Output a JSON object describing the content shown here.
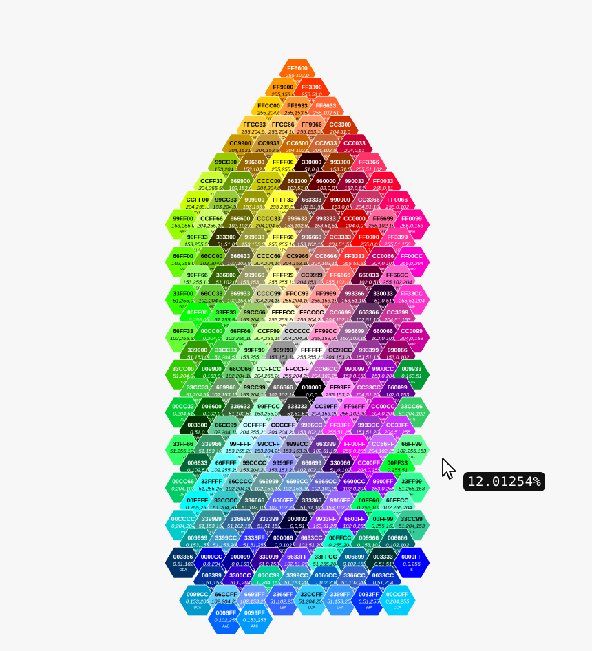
{
  "zoom_readout": "12.01254%",
  "cells": [
    [
      "FF6600",
      "255,102,0",
      "OOR"
    ],
    [
      "FF9900",
      "255,153,0",
      "OOY"
    ],
    [
      "FF3300",
      "255,51,0",
      "RRO"
    ],
    [
      "FFCC00",
      "255,204,0",
      "YYO"
    ],
    [
      "FF9933",
      "255,153,51",
      "LHO"
    ],
    [
      "FF6633",
      "255,102,51",
      "LRO"
    ],
    [
      "FFCC33",
      "255,204,51",
      "LYO"
    ],
    [
      "FFCC66",
      "255,204,102",
      "LOY"
    ],
    [
      "FF9966",
      "255,153,102",
      "LOR"
    ],
    [
      "CC3300",
      "204,51,0",
      "DRO"
    ],
    [
      "CC9900",
      "204,153,0",
      "DYO"
    ],
    [
      "CC9933",
      "204,153,51",
      "MOY"
    ],
    [
      "CC6600",
      "204,102,0",
      "DHO"
    ],
    [
      "CC6633",
      "204,102,51",
      "MOR"
    ],
    [
      "CC0033",
      "204,0,51",
      "DRP"
    ],
    [
      "99CC00",
      "153,204,0",
      "DYS"
    ],
    [
      "996600",
      "153,102,0",
      "DOY"
    ],
    [
      "FFFF00",
      "255,255,0",
      "Y"
    ],
    [
      "330000",
      "51,0,0",
      "OWR"
    ],
    [
      "993300",
      "153,51,0",
      "DOR"
    ],
    [
      "FF3366",
      "255,51,102",
      "LRP"
    ],
    [
      "CCFF33",
      "204,255,51",
      "LYS"
    ],
    [
      "669900",
      "102,153,0",
      "DSY"
    ],
    [
      "CCCC00",
      "204,204,0",
      "DHY"
    ],
    [
      "663300",
      "102,51,0",
      "ODO"
    ],
    [
      "660000",
      "102,0,0",
      "ODR"
    ],
    [
      "990033",
      "153,0,51",
      "DPR"
    ],
    [
      "FF0033",
      "255,0,51",
      "RRP"
    ],
    [
      "CCFF00",
      "204,255,0",
      "YYS"
    ],
    [
      "99CC33",
      "153,204,51",
      "MSY"
    ],
    [
      "999900",
      "153,153,0",
      "DFY"
    ],
    [
      "FFFF33",
      "255,255,51",
      "LHY"
    ],
    [
      "663333",
      "102,51,51",
      "DWR"
    ],
    [
      "990000",
      "153,0,0",
      "DFR"
    ],
    [
      "CC3366",
      "204,51,102",
      "MPR"
    ],
    [
      "FF0066",
      "255,0,102",
      "PPR"
    ],
    [
      "99FF00",
      "153,255,0",
      "SSY"
    ],
    [
      "CCFF66",
      "204,255,102",
      "LSY"
    ],
    [
      "666600",
      "102,102,0",
      "ODY"
    ],
    [
      "CCCC33",
      "204,204,51",
      "MFY"
    ],
    [
      "996633",
      "153,102,51",
      "DDO"
    ],
    [
      "993333",
      "153,51,51",
      "DDR"
    ],
    [
      "CC0000",
      "204,0,0",
      "DHR"
    ],
    [
      "FF6699",
      "255,102,153",
      "LPR"
    ],
    [
      "FF0099",
      "255,0,153",
      "PPM"
    ],
    [
      "99FF33",
      "153,255,51",
      "LHS"
    ],
    [
      "333300",
      "51,51,0",
      "OWY"
    ],
    [
      "999933",
      "153,153,51",
      "DDY"
    ],
    [
      "FFFF66",
      "255,255,102",
      "LFY"
    ],
    [
      "996666",
      "153,102,102",
      "MWR"
    ],
    [
      "CC3333",
      "204,51,51",
      "MFR"
    ],
    [
      "FF0000",
      "255,0,0",
      "R"
    ],
    [
      "FF3399",
      "255,51,153",
      "LHP"
    ],
    [
      "66FF00",
      "102,255,0",
      "SSG"
    ],
    [
      "66CC00",
      "102,204,0",
      "DHS"
    ],
    [
      "666633",
      "102,102,51",
      "DWY"
    ],
    [
      "CCCC66",
      "204,204,102",
      "LDY"
    ],
    [
      "CC9966",
      "204,153,102",
      "LDO"
    ],
    [
      "CC6666",
      "204,102,102",
      "LDR"
    ],
    [
      "FF3333",
      "255,51,51",
      "LHR"
    ],
    [
      "CC0066",
      "204,0,102",
      "DHP"
    ],
    [
      "FF00CC",
      "255,0,204",
      "MMP"
    ],
    [
      "99FF66",
      "153,255,102",
      "LSG"
    ],
    [
      "336600",
      "51,102,0",
      "OOS"
    ],
    [
      "999966",
      "153,153,102",
      "MWY"
    ],
    [
      "FFFF99",
      "255,255,153",
      "PDY"
    ],
    [
      "CC9999",
      "204,153,153",
      "LWR"
    ],
    [
      "FF6666",
      "255,102,102",
      "LFR"
    ],
    [
      "660033",
      "102,0,51",
      "ODP"
    ],
    [
      "FF66CC",
      "255,102,204",
      "LPM"
    ],
    [
      "33FF00",
      "51,255,0",
      "GGS"
    ],
    [
      "66CC33",
      "102,204,51",
      "MSG"
    ],
    [
      "669933",
      "102,153,51",
      "DDS"
    ],
    [
      "CCCC99",
      "204,204,153",
      "LWY"
    ],
    [
      "FFCC99",
      "255,204,153",
      "PDO"
    ],
    [
      "FF9999",
      "255,153,153",
      "PDR"
    ],
    [
      "993366",
      "153,51,102",
      "DDP"
    ],
    [
      "330033",
      "51,0,51",
      "OWM"
    ],
    [
      "FF33CC",
      "255,51,204",
      "LMP"
    ],
    [
      "00FF00",
      "0,255,0",
      "G"
    ],
    [
      "33FF33",
      "51,255,51",
      "LHG"
    ],
    [
      "99CC66",
      "153,204,102",
      "LDS"
    ],
    [
      "FFFFCC",
      "255,255,204",
      "PWY"
    ],
    [
      "FFCCCC",
      "255,204,204",
      "PWR"
    ],
    [
      "CC6699",
      "204,102,153",
      "LDP"
    ],
    [
      "663366",
      "102,51,102",
      "DWM"
    ],
    [
      "CC3399",
      "204,51,153",
      "MPM"
    ],
    [
      "66FF33",
      "102,255,51",
      "LGS"
    ],
    [
      "00CC00",
      "0,204,0",
      "DHG"
    ],
    [
      "66FF66",
      "102,255,102",
      "LFG"
    ],
    [
      "CCFF99",
      "204,255,153",
      "PDS"
    ],
    [
      "CCCCCC",
      "204,204,204",
      "PG"
    ],
    [
      "FF99CC",
      "255,153,204",
      "PDP"
    ],
    [
      "996699",
      "153,102,153",
      "MWM"
    ],
    [
      "660066",
      "102,0,102",
      "ODM"
    ],
    [
      "CC0099",
      "204,0,153",
      "DMP"
    ],
    [
      "339900",
      "51,153,0",
      "DSG"
    ],
    [
      "33CC33",
      "51,204,51",
      "MFG"
    ],
    [
      "99FF99",
      "153,255,153",
      "PDG"
    ],
    [
      "999999",
      "153,153,153",
      "LG"
    ],
    [
      "FFFFFF",
      "255,255,255",
      "W"
    ],
    [
      "CC99CC",
      "204,153,204",
      "LWM"
    ],
    [
      "993399",
      "153,51,153",
      "DDM"
    ],
    [
      "990066",
      "153,0,102",
      "DPM"
    ],
    [
      "33CC00",
      "51,204,0",
      "DGS"
    ],
    [
      "009900",
      "0,153,0",
      "DFG"
    ],
    [
      "66CC66",
      "102,204,102",
      "LDG"
    ],
    [
      "CCFFCC",
      "204,255,204",
      "PWG"
    ],
    [
      "FFCCFF",
      "255,204,255",
      "PWM"
    ],
    [
      "CC66CC",
      "204,102,204",
      "LDM"
    ],
    [
      "990099",
      "153,0,153",
      "DFM"
    ],
    [
      "9900CC",
      "153,0,204",
      "DMV"
    ],
    [
      "009933",
      "0,153,51",
      "DTG"
    ],
    [
      "33CC33",
      "51,204,51",
      "MFG"
    ],
    [
      "669966",
      "102,153,102",
      "MWG"
    ],
    [
      "99CC99",
      "153,204,153",
      "LWG"
    ],
    [
      "666666",
      "102,102,102",
      "DG"
    ],
    [
      "000000",
      "0,0,0",
      "K"
    ],
    [
      "FF99FF",
      "255,153,255",
      "PDM"
    ],
    [
      "CC33CC",
      "204,51,204",
      "MFM"
    ],
    [
      "660099",
      "102,0,153",
      "DVM"
    ],
    [
      "00CC33",
      "0,204,51",
      "DGT"
    ],
    [
      "006600",
      "0,102,0",
      "ODG"
    ],
    [
      "336633",
      "51,102,51",
      "DWG"
    ],
    [
      "99FFCC",
      "153,255,204",
      "PDT"
    ],
    [
      "333333",
      "51,51,51",
      "OG"
    ],
    [
      "CC99FF",
      "204,153,255",
      "PDV"
    ],
    [
      "FF66FF",
      "255,102,255",
      "LFM"
    ],
    [
      "CC00CC",
      "204,0,204",
      "DHM"
    ],
    [
      "33CC66",
      "51,204,102",
      "MTG"
    ],
    [
      "003300",
      "0,51,0",
      "OWG"
    ],
    [
      "66CC99",
      "102,204,153",
      "LDT"
    ],
    [
      "CCFFFF",
      "204,255,255",
      "PWC"
    ],
    [
      "CCCCFF",
      "204,204,255",
      "PWB"
    ],
    [
      "9966CC",
      "153,102,204",
      "LDV"
    ],
    [
      "FF33FF",
      "255,51,255",
      "LHM"
    ],
    [
      "9933CC",
      "153,51,204",
      "MVM"
    ],
    [
      "CC33FF",
      "204,51,255",
      "LMV"
    ],
    [
      "33FF66",
      "51,255,102",
      "LGT"
    ],
    [
      "339966",
      "51,153,102",
      "DDT"
    ],
    [
      "99FFFF",
      "153,255,255",
      "PDC"
    ],
    [
      "99CCFF",
      "153,204,255",
      "PDA"
    ],
    [
      "9999CC",
      "153,153,204",
      "LWB"
    ],
    [
      "663399",
      "102,51,153",
      "DDV"
    ],
    [
      "FF00FF",
      "255,0,255",
      "M"
    ],
    [
      "CC66FF",
      "204,102,255",
      "LVM"
    ],
    [
      "66FF99",
      "102,255,153",
      "LTG"
    ],
    [
      "006633",
      "0,102,51",
      "ODT"
    ],
    [
      "66FFFF",
      "102,255,255",
      "LFC"
    ],
    [
      "99CCCC",
      "153,204,204",
      "LWC"
    ],
    [
      "9999FF",
      "153,153,255",
      "PDB"
    ],
    [
      "666699",
      "102,102,153",
      "MWB"
    ],
    [
      "330066",
      "51,0,102",
      "ODV"
    ],
    [
      "CC00FF",
      "204,0,255",
      "VVM"
    ],
    [
      "00FF33",
      "0,255,51",
      "GGT"
    ],
    [
      "00CC66",
      "0,204,102",
      "DHT"
    ],
    [
      "33FFFF",
      "51,255,255",
      "LHC"
    ],
    [
      "66CCCC",
      "102,204,204",
      "LDC"
    ],
    [
      "669999",
      "102,153,153",
      "MWC"
    ],
    [
      "6699CC",
      "102,153,204",
      "LDA"
    ],
    [
      "6666CC",
      "102,102,204",
      "LDB"
    ],
    [
      "6600CC",
      "102,0,204",
      "DHV"
    ],
    [
      "9900FF",
      "153,0,255",
      "VVM"
    ],
    [
      "33FF99",
      "51,255,153",
      "LHT"
    ],
    [
      "00FFFF",
      "0,255,255",
      "C"
    ],
    [
      "33CCCC",
      "51,204,204",
      "MFC"
    ],
    [
      "336666",
      "51,102,102",
      "DWC"
    ],
    [
      "6666FF",
      "102,102,255",
      "LFB"
    ],
    [
      "333366",
      "51,51,102",
      "DWB"
    ],
    [
      "9966FF",
      "153,102,255",
      "LHV"
    ],
    [
      "00FF66",
      "0,255,102",
      "TTG"
    ],
    [
      "66FFCC",
      "102,255,204",
      "LTC"
    ],
    [
      "00CCCC",
      "0,204,204",
      "DHC"
    ],
    [
      "339999",
      "51,153,153",
      "DDC"
    ],
    [
      "336699",
      "51,102,153",
      "DDA"
    ],
    [
      "333399",
      "51,51,153",
      "DDB"
    ],
    [
      "000033",
      "0,0,51",
      "OWB"
    ],
    [
      "9933FF",
      "153,51,255",
      "LHV"
    ],
    [
      "6600FF",
      "102,0,255",
      "VVB"
    ],
    [
      "00FF99",
      "0,255,153",
      "TTC"
    ],
    [
      "33CC99",
      "51,204,153",
      "MTC"
    ],
    [
      "009999",
      "0,153,153",
      "DFC"
    ],
    [
      "3399CC",
      "51,153,204",
      "MAC"
    ],
    [
      "3333FF",
      "51,51,255",
      "LHB"
    ],
    [
      "000066",
      "0,0,102",
      "ODB"
    ],
    [
      "6633CC",
      "102,51,204",
      "MVB"
    ],
    [
      "00FFCC",
      "0,255,204",
      "CCT"
    ],
    [
      "009966",
      "0,153,102",
      "DTC"
    ],
    [
      "006666",
      "0,102,102",
      "ODC"
    ],
    [
      "003366",
      "0,51,102",
      "ODA"
    ],
    [
      "0000CC",
      "0,0,204",
      "DHB"
    ],
    [
      "000099",
      "0,0,153",
      "DFB"
    ],
    [
      "330099",
      "51,0,153",
      "DVB"
    ],
    [
      "6633FF",
      "102,51,255",
      "LBV"
    ],
    [
      "33FFCC",
      "51,255,204",
      "LCT"
    ],
    [
      "006699",
      "0,102,153",
      "DAC"
    ],
    [
      "003333",
      "0,51,51",
      "OWC"
    ],
    [
      "0000FF",
      "0,0,255",
      "B"
    ],
    [
      "003399",
      "0,51,153",
      "DAB"
    ],
    [
      "3300CC",
      "51,0,204",
      "DBV"
    ],
    [
      "00CC99",
      "0,204,153",
      "DCT"
    ],
    [
      "3399CC",
      "51,153,204",
      "MAC"
    ],
    [
      "0066CC",
      "0,102,204",
      "DHA"
    ],
    [
      "3366CC",
      "51,102,204",
      "MAB"
    ],
    [
      "0033CC",
      "0,51,204",
      "DBA"
    ],
    [
      "0099CC",
      "0,153,204",
      "DCA"
    ],
    [
      "66CCFF",
      "102,204,255",
      "LAC"
    ],
    [
      "6699FF",
      "102,153,255",
      "LAB"
    ],
    [
      "3366FF",
      "51,102,255",
      "LBA"
    ],
    [
      "33CCFF",
      "51,204,255",
      "LCA"
    ],
    [
      "3399FF",
      "51,153,255",
      "LHA"
    ],
    [
      "0033FF",
      "0,51,255",
      "BBA"
    ],
    [
      "00CCFF",
      "0,204,255",
      "CCA"
    ],
    [
      "0066FF",
      "0,102,255",
      "AAB"
    ],
    [
      "0099FF",
      "0,153,255",
      "AAC"
    ]
  ]
}
